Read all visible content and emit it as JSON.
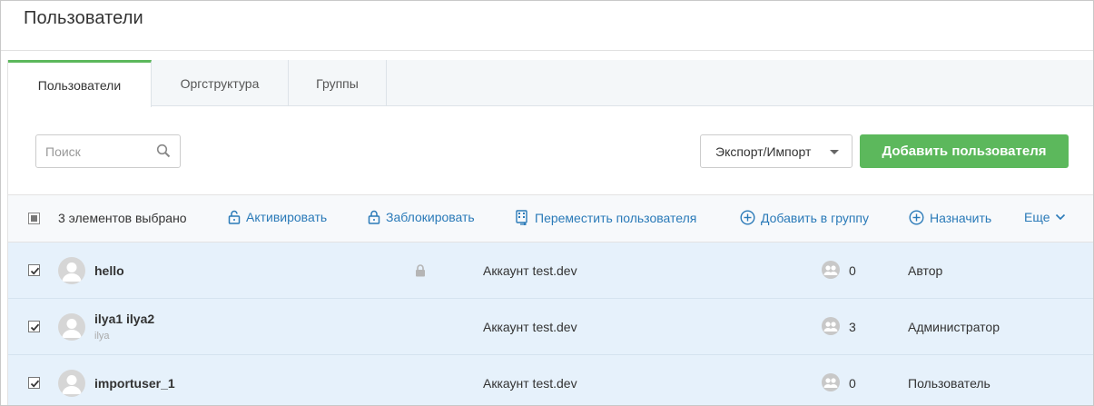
{
  "page": {
    "title": "Пользователи"
  },
  "tabs": [
    {
      "label": "Пользователи",
      "active": true
    },
    {
      "label": "Оргструктура",
      "active": false
    },
    {
      "label": "Группы",
      "active": false
    }
  ],
  "toolbar": {
    "search_placeholder": "Поиск",
    "export_label": "Экспорт/Импорт",
    "add_label": "Добавить пользователя"
  },
  "actions": {
    "selected_count": "3 элементов выбрано",
    "activate": "Активировать",
    "block": "Заблокировать",
    "move": "Переместить пользователя",
    "add_to_group": "Добавить в группу",
    "assign": "Назначить",
    "more": "Еще"
  },
  "users": [
    {
      "name": "hello",
      "login": "",
      "locked": true,
      "account": "Аккаунт test.dev",
      "groups": "0",
      "role": "Автор",
      "checked": true
    },
    {
      "name": "ilya1 ilya2",
      "login": "ilya",
      "locked": false,
      "account": "Аккаунт test.dev",
      "groups": "3",
      "role": "Администратор",
      "checked": true
    },
    {
      "name": "importuser_1",
      "login": "",
      "locked": false,
      "account": "Аккаунт test.dev",
      "groups": "0",
      "role": "Пользователь",
      "checked": true
    }
  ],
  "colors": {
    "accent_green": "#5cb85c",
    "link_blue": "#2a7ab8",
    "row_selected": "#e6f1fb"
  }
}
